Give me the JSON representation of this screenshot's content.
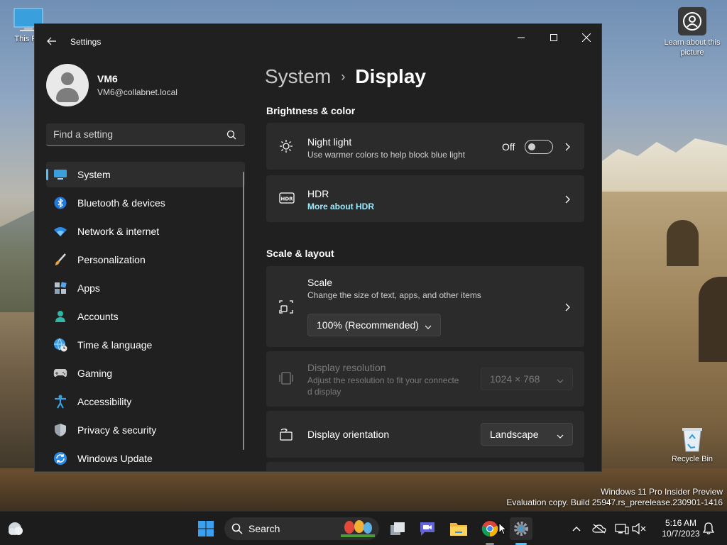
{
  "desktop": {
    "icons": [
      {
        "label": "This PC"
      },
      {
        "label": "Learn about this picture"
      },
      {
        "label": "Recycle Bin"
      }
    ],
    "watermark": {
      "line1": "Windows 11 Pro Insider Preview",
      "line2": "Evaluation copy. Build 25947.rs_prerelease.230901-1416"
    }
  },
  "window": {
    "title": "Settings",
    "profile": {
      "name": "VM6",
      "email": "VM6@collabnet.local"
    },
    "search": {
      "placeholder": "Find a setting"
    },
    "nav": [
      {
        "label": "System",
        "icon": "monitor-icon",
        "active": true
      },
      {
        "label": "Bluetooth & devices",
        "icon": "bluetooth-icon"
      },
      {
        "label": "Network & internet",
        "icon": "wifi-icon"
      },
      {
        "label": "Personalization",
        "icon": "brush-icon"
      },
      {
        "label": "Apps",
        "icon": "apps-icon"
      },
      {
        "label": "Accounts",
        "icon": "person-icon"
      },
      {
        "label": "Time & language",
        "icon": "globe-clock-icon"
      },
      {
        "label": "Gaming",
        "icon": "gamepad-icon"
      },
      {
        "label": "Accessibility",
        "icon": "accessibility-icon"
      },
      {
        "label": "Privacy & security",
        "icon": "shield-icon"
      },
      {
        "label": "Windows Update",
        "icon": "update-icon"
      }
    ],
    "breadcrumb": {
      "parent": "System",
      "separator": "›",
      "current": "Display"
    },
    "sections": {
      "brightness": {
        "title": "Brightness & color",
        "night_light": {
          "title": "Night light",
          "desc": "Use warmer colors to help block blue light",
          "state": "Off"
        },
        "hdr": {
          "title": "HDR",
          "link": "More about HDR"
        }
      },
      "scale_layout": {
        "title": "Scale & layout",
        "scale": {
          "title": "Scale",
          "desc": "Change the size of text, apps, and other items",
          "value": "100% (Recommended)"
        },
        "resolution": {
          "title": "Display resolution",
          "desc_line1": "Adjust the resolution to fit your connecte",
          "desc_line2": "d display",
          "value": "1024 × 768"
        },
        "orientation": {
          "title": "Display orientation",
          "value": "Landscape"
        }
      }
    }
  },
  "taskbar": {
    "search_label": "Search",
    "clock": {
      "time": "5:16 AM",
      "date": "10/7/2023"
    }
  },
  "colors": {
    "accent": "#4cc2ff",
    "link": "#99ebff",
    "window_bg": "#202020",
    "card_bg": "#2b2b2b"
  }
}
